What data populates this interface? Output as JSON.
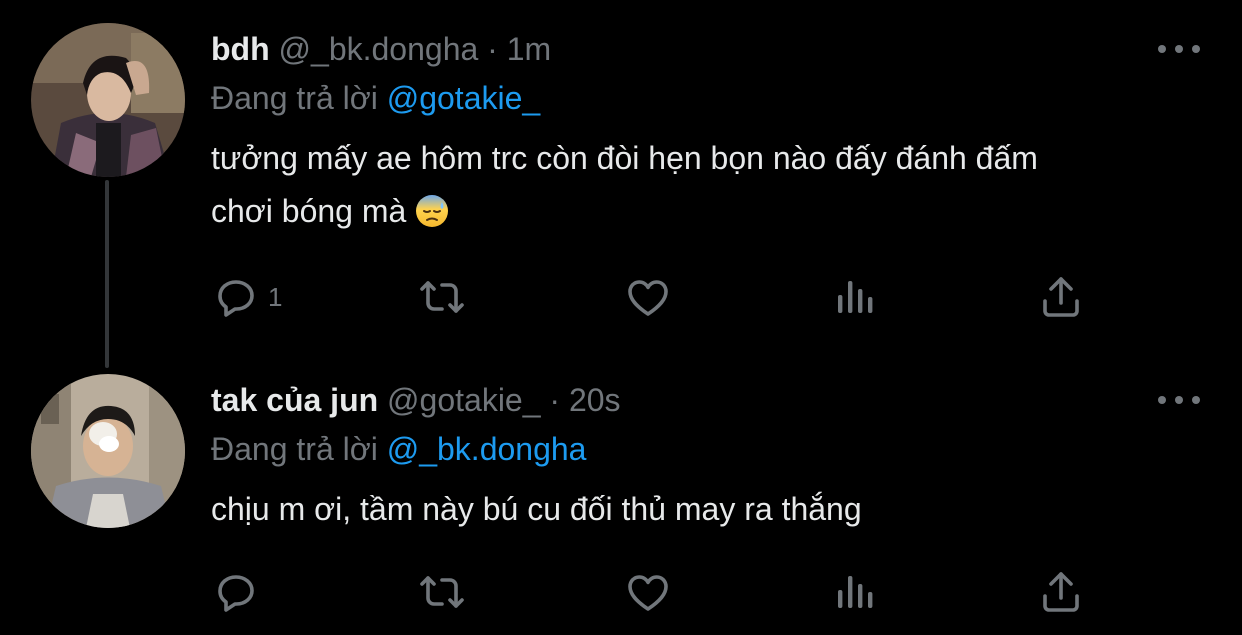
{
  "tweets": [
    {
      "name": "bdh",
      "handle": "@_bk.dongha",
      "separator": "·",
      "time": "1m",
      "reply_prefix": "Đang trả lời",
      "reply_mention": "@gotakie_",
      "text_line1": "tưởng mấy ae hôm trc còn đòi hẹn bọn nào đấy đánh đấm",
      "text_line2": "chơi bóng mà",
      "emoji": "downcast-face-with-sweat",
      "reply_count": "1"
    },
    {
      "name": "tak của jun",
      "handle": "@gotakie_",
      "separator": "·",
      "time": "20s",
      "reply_prefix": "Đang trả lời",
      "reply_mention": "@_bk.dongha",
      "text_line1": "chịu m ơi, tầm này bú cu đối thủ may ra thắng",
      "reply_count": ""
    }
  ],
  "colors": {
    "background": "#000000",
    "text": "#e7e9ea",
    "muted": "#71767b",
    "accent": "#1d9bf0",
    "thread_line": "#333639"
  },
  "icons": [
    "reply-icon",
    "retweet-icon",
    "like-icon",
    "views-icon",
    "share-icon",
    "more-icon"
  ]
}
